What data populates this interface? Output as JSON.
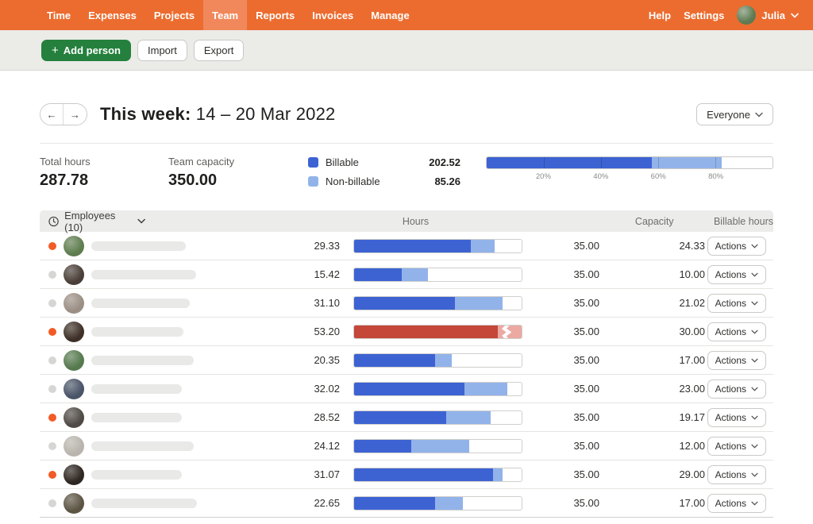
{
  "nav": {
    "items": [
      {
        "label": "Time"
      },
      {
        "label": "Expenses"
      },
      {
        "label": "Projects"
      },
      {
        "label": "Team"
      },
      {
        "label": "Reports"
      },
      {
        "label": "Invoices"
      },
      {
        "label": "Manage"
      }
    ],
    "active": "Team",
    "help": "Help",
    "settings": "Settings",
    "user": "Julia"
  },
  "toolbar": {
    "add_person": "Add person",
    "import": "Import",
    "export": "Export"
  },
  "header": {
    "title_prefix": "This week:",
    "title_date": "14 – 20 Mar 2022",
    "prev": "←",
    "next": "→",
    "filter": "Everyone"
  },
  "summary": {
    "total_hours_label": "Total hours",
    "total_hours": "287.78",
    "capacity_label": "Team capacity",
    "capacity": "350.00",
    "legend": [
      {
        "label": "Billable",
        "value": "202.52",
        "color": "#3d63d3"
      },
      {
        "label": "Non-billable",
        "value": "85.26",
        "color": "#92b3ea"
      }
    ],
    "progress": {
      "billable_pct": 57.86,
      "nonbillable_pct": 24.36,
      "ticks": [
        {
          "label": "20%",
          "pct": 20
        },
        {
          "label": "40%",
          "pct": 40
        },
        {
          "label": "60%",
          "pct": 60
        },
        {
          "label": "80%",
          "pct": 80
        }
      ]
    }
  },
  "colors": {
    "billable": "#3d63d3",
    "nonbillable": "#92b3ea",
    "over_billable": "#c4473a",
    "over_nonbillable": "#eba9a2",
    "dot_active": "#f25b26",
    "dot_inactive": "#d6d6d4"
  },
  "table": {
    "employees_label": "Employees (10)",
    "columns": {
      "hours": "Hours",
      "capacity": "Capacity",
      "billable": "Billable hours"
    },
    "actions_label": "Actions",
    "rows": [
      {
        "dot": "orange",
        "avatar": "#5f7d4f",
        "name_w": 119,
        "hours": "29.33",
        "capacity": "35.00",
        "billable": "24.33"
      },
      {
        "dot": "gray",
        "avatar": "#4a3f38",
        "name_w": 132,
        "hours": "15.42",
        "capacity": "35.00",
        "billable": "10.00"
      },
      {
        "dot": "gray",
        "avatar": "#9b8f85",
        "name_w": 124,
        "hours": "31.10",
        "capacity": "35.00",
        "billable": "21.02"
      },
      {
        "dot": "orange",
        "avatar": "#3e3028",
        "name_w": 116,
        "hours": "53.20",
        "capacity": "35.00",
        "billable": "30.00"
      },
      {
        "dot": "gray",
        "avatar": "#567a4e",
        "name_w": 129,
        "hours": "20.35",
        "capacity": "35.00",
        "billable": "17.00"
      },
      {
        "dot": "gray",
        "avatar": "#4a5568",
        "name_w": 114,
        "hours": "32.02",
        "capacity": "35.00",
        "billable": "23.00"
      },
      {
        "dot": "orange",
        "avatar": "#4f4a45",
        "name_w": 114,
        "hours": "28.52",
        "capacity": "35.00",
        "billable": "19.17"
      },
      {
        "dot": "gray",
        "avatar": "#b9b4ad",
        "name_w": 129,
        "hours": "24.12",
        "capacity": "35.00",
        "billable": "12.00"
      },
      {
        "dot": "orange",
        "avatar": "#2e2620",
        "name_w": 114,
        "hours": "31.07",
        "capacity": "35.00",
        "billable": "29.00"
      },
      {
        "dot": "gray",
        "avatar": "#5d5544",
        "name_w": 133,
        "hours": "22.65",
        "capacity": "35.00",
        "billable": "17.00"
      }
    ]
  }
}
